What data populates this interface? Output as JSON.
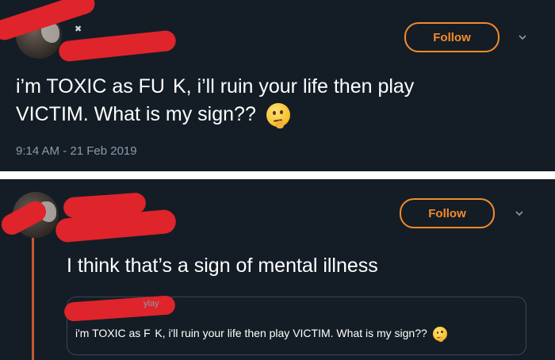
{
  "tweet1": {
    "follow_label": "Follow",
    "text_line1": "i’m TOXIC as FU  K, i’ll ruin your life then play",
    "text_line2": "VICTIM. What is my sign??",
    "timestamp": "9:14 AM - 21 Feb 2019"
  },
  "tweet2": {
    "follow_label": "Follow",
    "text": "I think that’s a sign of mental illness",
    "quote_handle_fragment": "ylay",
    "quote_text": "i'm TOXIC as F  K, i'll ruin your life then play VICTIM. What is my sign??"
  },
  "colors": {
    "background": "#141d26",
    "accent": "#f58b2a",
    "redaction": "#e0242b",
    "muted_text": "#8a9bab"
  },
  "icons": [
    "chevron-down-icon",
    "thinking-face-emoji",
    "verified-badge-icon"
  ]
}
